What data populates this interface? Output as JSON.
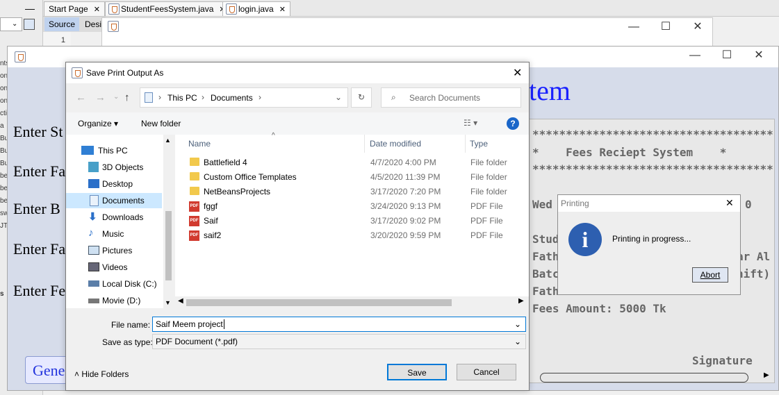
{
  "ide": {
    "tabs": [
      "Start Page",
      "StudentFeesSystem.java",
      "login.java"
    ],
    "source_tab": "Source",
    "design_tab": "Desig",
    "line_number": "1",
    "left_fragments": [
      "nts",
      "on",
      "on",
      "on",
      "ctio",
      "a",
      "Bu",
      "Bu",
      "Bu",
      "be",
      "be",
      "be",
      "sw",
      "JT"
    ],
    "bottom_fragment": "s"
  },
  "app": {
    "title_fragment": "tem",
    "labels": [
      "Enter St",
      "Enter Fa",
      "Enter B",
      "Enter Fa",
      "Enter Fe"
    ],
    "generate_button": "Gene",
    "receipt": {
      "lines": [
        "************************************",
        "*    Fees Reciept System    *",
        "************************************",
        "Wed",
        "0",
        "Stud",
        "Fath",
        "ar Al",
        "Batc",
        "hift)",
        "Fath",
        "Fees Amount: 5000 Tk",
        "Signature"
      ]
    }
  },
  "dialog": {
    "title": "Save Print Output As",
    "path": [
      "This PC",
      "Documents"
    ],
    "search_placeholder": "Search Documents",
    "organize": "Organize",
    "new_folder": "New folder",
    "help": "?",
    "nav": [
      "This PC",
      "3D Objects",
      "Desktop",
      "Documents",
      "Downloads",
      "Music",
      "Pictures",
      "Videos",
      "Local Disk (C:)",
      "Movie (D:)"
    ],
    "selected_nav": "Documents",
    "columns": [
      "Name",
      "Date modified",
      "Type"
    ],
    "files": [
      {
        "name": "Battlefield 4",
        "date": "4/7/2020 4:00 PM",
        "type": "File folder",
        "kind": "folder"
      },
      {
        "name": "Custom Office Templates",
        "date": "4/5/2020 11:39 PM",
        "type": "File folder",
        "kind": "folder"
      },
      {
        "name": "NetBeansProjects",
        "date": "3/17/2020 7:20 PM",
        "type": "File folder",
        "kind": "folder"
      },
      {
        "name": "fggf",
        "date": "3/24/2020 9:13 PM",
        "type": "PDF File",
        "kind": "pdf"
      },
      {
        "name": "Saif",
        "date": "3/17/2020 9:02 PM",
        "type": "PDF File",
        "kind": "pdf"
      },
      {
        "name": "saif2",
        "date": "3/20/2020 9:59 PM",
        "type": "PDF File",
        "kind": "pdf"
      }
    ],
    "file_name_label": "File name:",
    "file_name_value": "Saif Meem project",
    "save_type_label": "Save as type:",
    "save_type_value": "PDF Document (*.pdf)",
    "hide_folders": "Hide Folders",
    "save": "Save",
    "cancel": "Cancel"
  },
  "printing": {
    "title": "Printing",
    "message": "Printing in progress...",
    "abort": "Abort",
    "icon": "info-icon"
  }
}
